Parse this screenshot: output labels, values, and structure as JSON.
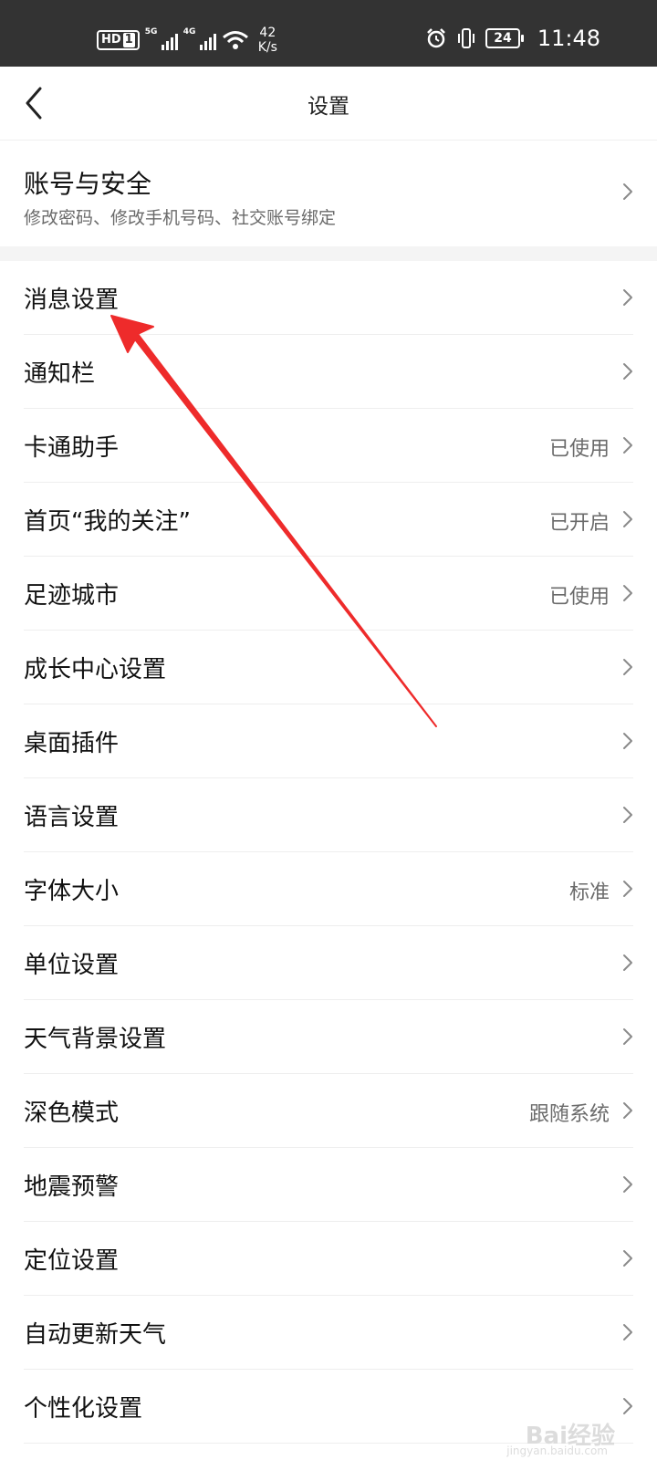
{
  "status_bar": {
    "hd_label": "HD",
    "sim_label": "1",
    "sim1_net": "5G",
    "sim2_net": "4G",
    "speed_value": "42",
    "speed_unit": "K/s",
    "battery": "24",
    "time": "11:48"
  },
  "header": {
    "title": "设置"
  },
  "account": {
    "title": "账号与安全",
    "subtitle": "修改密码、修改手机号码、社交账号绑定"
  },
  "settings": [
    {
      "label": "消息设置",
      "value": ""
    },
    {
      "label": "通知栏",
      "value": ""
    },
    {
      "label": "卡通助手",
      "value": "已使用"
    },
    {
      "label": "首页“我的关注”",
      "value": "已开启"
    },
    {
      "label": "足迹城市",
      "value": "已使用"
    },
    {
      "label": "成长中心设置",
      "value": ""
    },
    {
      "label": "桌面插件",
      "value": ""
    },
    {
      "label": "语言设置",
      "value": ""
    },
    {
      "label": "字体大小",
      "value": "标准"
    },
    {
      "label": "单位设置",
      "value": ""
    },
    {
      "label": "天气背景设置",
      "value": ""
    },
    {
      "label": "深色模式",
      "value": "跟随系统"
    },
    {
      "label": "地震预警",
      "value": ""
    },
    {
      "label": "定位设置",
      "value": ""
    },
    {
      "label": "自动更新天气",
      "value": ""
    },
    {
      "label": "个性化设置",
      "value": ""
    }
  ],
  "watermark": {
    "text": "Bai经验",
    "sub": "jingyan.baidu.com"
  },
  "colors": {
    "status_bar_bg": "#333333",
    "arrow": "#ee2b2b",
    "section_gap": "#f4f4f4"
  }
}
